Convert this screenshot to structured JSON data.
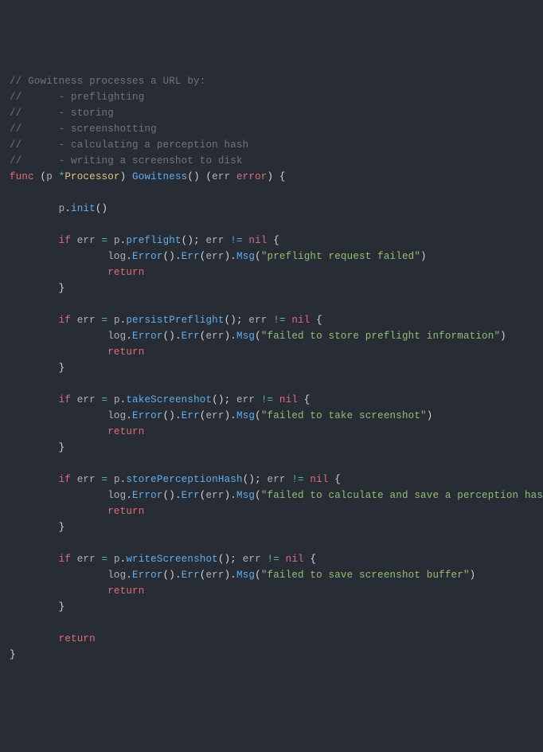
{
  "comments": {
    "c1": "// Gowitness processes a URL by:",
    "c2": "//      - preflighting",
    "c3": "//      - storing",
    "c4": "//      - screenshotting",
    "c5": "//      - calculating a perception hash",
    "c6": "//      - writing a screenshot to disk"
  },
  "kw": {
    "func": "func",
    "if": "if",
    "return": "return",
    "nil": "nil",
    "error": "error"
  },
  "id": {
    "p": "p",
    "err": "err",
    "log": "log"
  },
  "ty": {
    "Processor": "Processor"
  },
  "fn": {
    "Gowitness": "Gowitness",
    "init": "init",
    "preflight": "preflight",
    "persistPreflight": "persistPreflight",
    "takeScreenshot": "takeScreenshot",
    "storePerceptionHash": "storePerceptionHash",
    "writeScreenshot": "writeScreenshot",
    "Error": "Error",
    "Err": "Err",
    "Msg": "Msg"
  },
  "str": {
    "s1": "\"preflight request failed\"",
    "s2": "\"failed to store preflight information\"",
    "s3": "\"failed to take screenshot\"",
    "s4": "\"failed to calculate and save a perception hash\"",
    "s5": "\"failed to save screenshot buffer\""
  },
  "op": {
    "star": "*",
    "neq": "!=",
    "eq": "="
  },
  "punct": {
    "lpar": "(",
    "rpar": ")",
    "lbrace": "{",
    "rbrace": "}",
    "dot": ".",
    "semi": ";",
    "sp": " "
  }
}
